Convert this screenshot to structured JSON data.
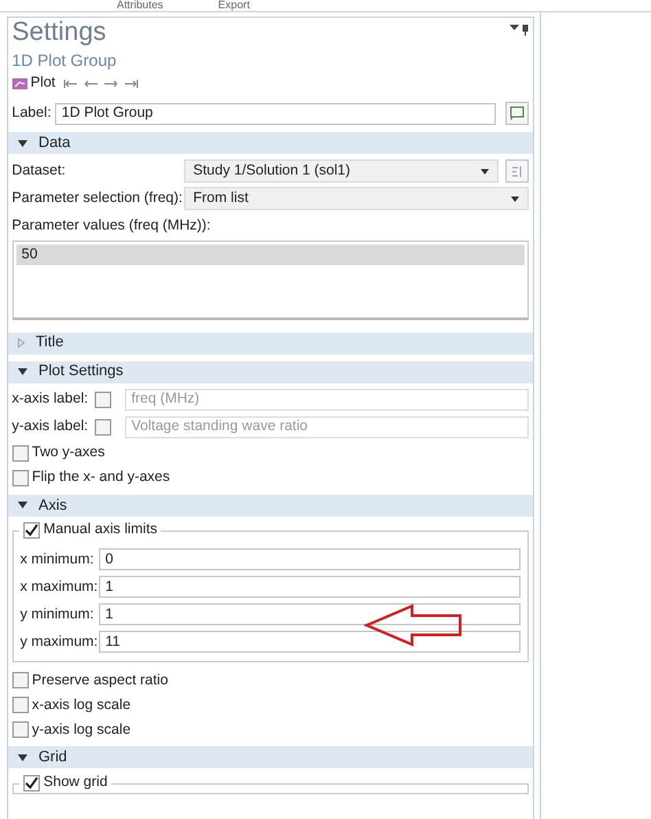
{
  "tabs": [
    {
      "label": "Attributes"
    },
    {
      "label": "Export"
    }
  ],
  "panel": {
    "title": "Settings",
    "subtitle": "1D Plot Group",
    "toolbar_label": "Plot",
    "label_field": {
      "label": "Label:",
      "value": "1D Plot Group"
    }
  },
  "sections": [
    {
      "title": "Data",
      "expanded": true,
      "items": [
        {
          "kind": "select",
          "label": "Dataset:",
          "value": "Study 1/Solution 1 (sol1)",
          "side_button": true
        },
        {
          "kind": "select",
          "label": "Parameter selection (freq):",
          "value": "From list",
          "side_button": false
        },
        {
          "kind": "caption",
          "text": "Parameter values (freq (MHz)):"
        },
        {
          "kind": "listbox",
          "rows": [
            {
              "text": "50",
              "selected": true
            }
          ]
        }
      ]
    },
    {
      "title": "Title",
      "expanded": false
    },
    {
      "title": "Plot Settings",
      "expanded": true,
      "items": [
        {
          "kind": "label_check",
          "label": "x-axis label:",
          "checked": false,
          "value": "freq (MHz)",
          "disabled": true
        },
        {
          "kind": "label_check",
          "label": "y-axis label:",
          "checked": false,
          "value": "Voltage standing wave ratio",
          "disabled": true
        },
        {
          "kind": "checkbox",
          "label": "Two y-axes",
          "checked": false
        },
        {
          "kind": "checkbox",
          "label": "Flip the x- and y-axes",
          "checked": false
        }
      ]
    },
    {
      "title": "Axis",
      "expanded": true,
      "items": [
        {
          "kind": "group",
          "label": "Manual axis limits",
          "checked": true,
          "annotation": {
            "kind": "arrow"
          },
          "fields": [
            {
              "label": "x minimum:",
              "value": "0"
            },
            {
              "label": "x maximum:",
              "value": "1"
            },
            {
              "label": "y minimum:",
              "value": "1"
            },
            {
              "label": "y maximum:",
              "value": "11"
            }
          ]
        },
        {
          "kind": "checkbox",
          "label": "Preserve aspect ratio",
          "checked": false
        },
        {
          "kind": "checkbox",
          "label": "x-axis log scale",
          "checked": false
        },
        {
          "kind": "checkbox",
          "label": "y-axis log scale",
          "checked": false
        }
      ]
    },
    {
      "title": "Grid",
      "expanded": true,
      "items": [
        {
          "kind": "group",
          "label": "Show grid",
          "checked": true
        }
      ]
    }
  ]
}
